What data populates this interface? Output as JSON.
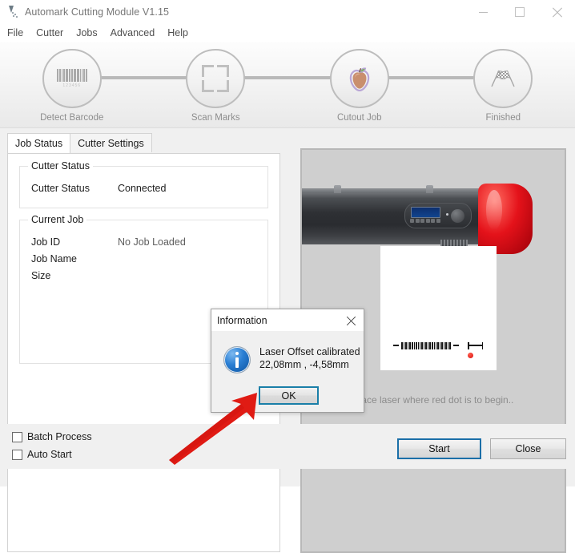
{
  "window": {
    "title": "Automark Cutting Module V1.15",
    "icon": "cutter-blade-icon",
    "controls": {
      "minimize": "minimize-icon",
      "maximize": "maximize-icon",
      "close": "close-icon"
    }
  },
  "menubar": {
    "items": [
      {
        "label": "File"
      },
      {
        "label": "Cutter"
      },
      {
        "label": "Jobs"
      },
      {
        "label": "Advanced"
      },
      {
        "label": "Help"
      }
    ]
  },
  "wizard": {
    "steps": [
      {
        "label": "Detect Barcode",
        "icon": "barcode-icon"
      },
      {
        "label": "Scan Marks",
        "icon": "crop-marks-icon"
      },
      {
        "label": "Cutout Job",
        "icon": "apple-sticker-icon"
      },
      {
        "label": "Finished",
        "icon": "checkered-flags-icon"
      }
    ]
  },
  "tabs": [
    {
      "label": "Job Status",
      "active": true
    },
    {
      "label": "Cutter Settings",
      "active": false
    }
  ],
  "job_status": {
    "cutter_status_group": {
      "legend": "Cutter Status",
      "rows": [
        {
          "key": "Cutter Status",
          "value": "Connected"
        }
      ]
    },
    "current_job_group": {
      "legend": "Current Job",
      "rows": [
        {
          "key": "Job ID",
          "value": "No Job Loaded"
        },
        {
          "key": "Job Name",
          "value": ""
        },
        {
          "key": "Size",
          "value": ""
        }
      ]
    }
  },
  "preview": {
    "caption": "Place laser where red dot is to begin..",
    "machine": "vinyl-cutter-illustration",
    "red_dot_color": "#d81111"
  },
  "dialog": {
    "title": "Information",
    "icon": "info-icon",
    "message": "Laser Offset calibrated\n22,08mm , -4,58mm",
    "ok_label": "OK",
    "close": "close-icon",
    "focus_color": "#1a7fa8"
  },
  "annotation": {
    "arrow": "red-arrow-pointing-to-ok",
    "color": "#e01b14"
  },
  "footer": {
    "checkboxes": [
      {
        "label": "Batch Process",
        "checked": false
      },
      {
        "label": "Auto Start",
        "checked": false
      }
    ],
    "buttons": [
      {
        "label": "Start",
        "focused": true
      },
      {
        "label": "Close",
        "focused": false
      }
    ]
  }
}
